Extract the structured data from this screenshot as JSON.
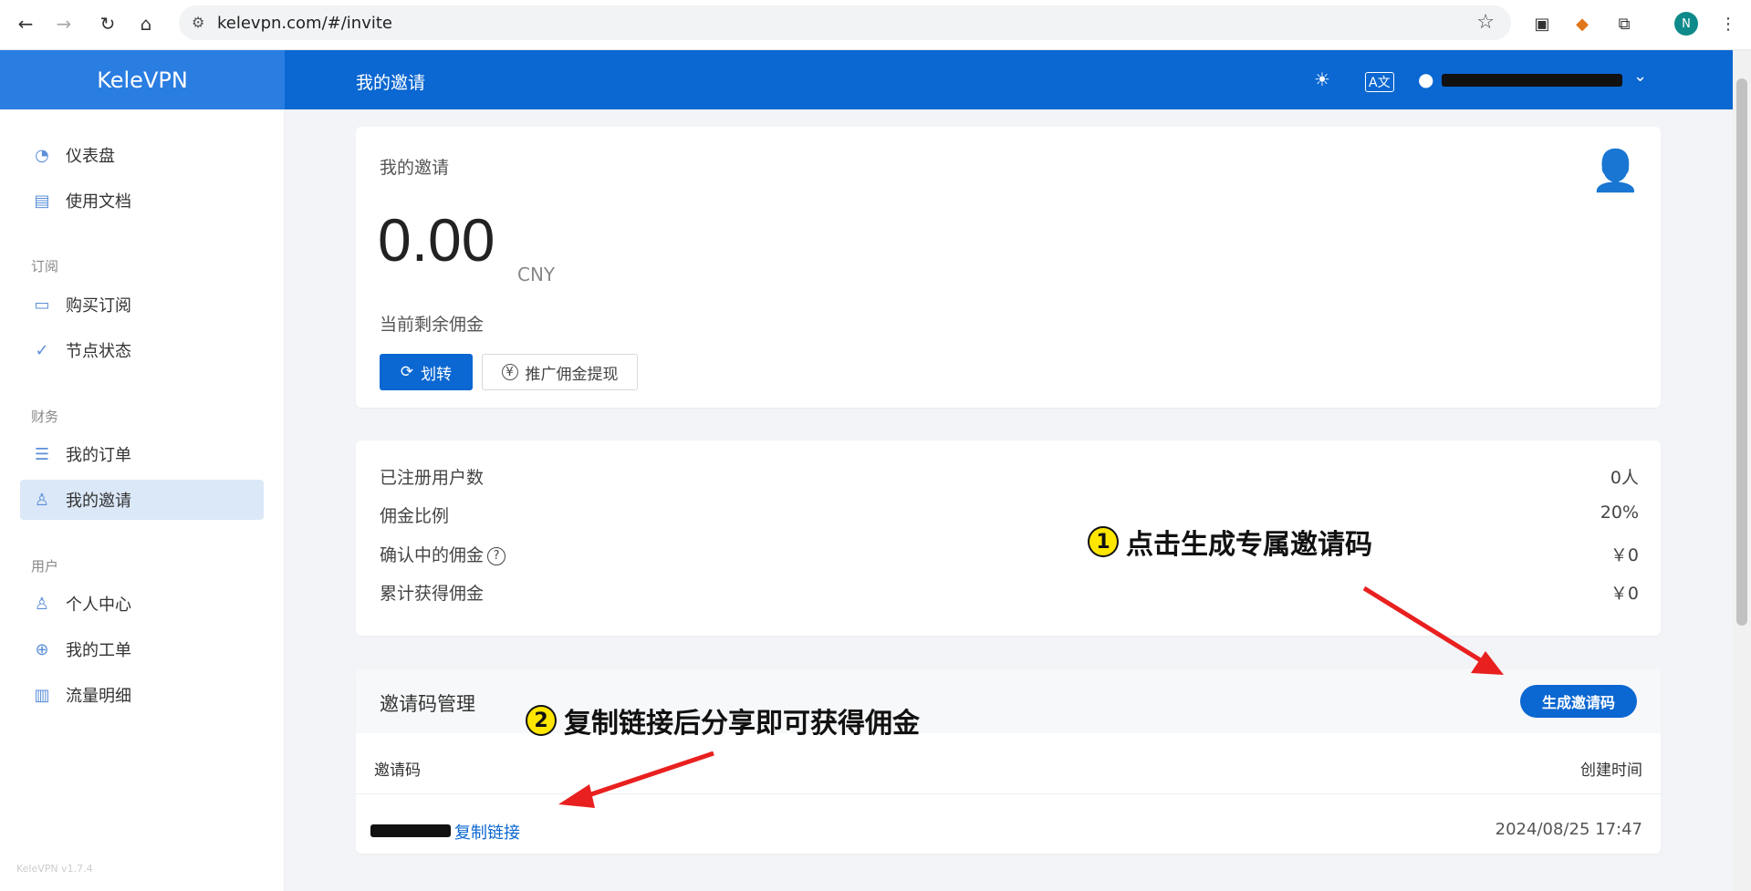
{
  "browser": {
    "url": "kelevpn.com/#/invite",
    "profile_initial": "N"
  },
  "app": {
    "brand": "KeleVPN",
    "page_title": "我的邀请",
    "version": "KeleVPN v1.7.4"
  },
  "sidebar": {
    "items_top": [
      {
        "label": "仪表盘",
        "icon": "dashboard-icon"
      },
      {
        "label": "使用文档",
        "icon": "book-icon"
      }
    ],
    "group_subscribe": "订阅",
    "items_subscribe": [
      {
        "label": "购买订阅",
        "icon": "bag-icon"
      },
      {
        "label": "节点状态",
        "icon": "check-circle-icon"
      }
    ],
    "group_finance": "财务",
    "items_finance": [
      {
        "label": "我的订单",
        "icon": "list-icon"
      },
      {
        "label": "我的邀请",
        "icon": "users-icon"
      }
    ],
    "group_user": "用户",
    "items_user": [
      {
        "label": "个人中心",
        "icon": "user-icon"
      },
      {
        "label": "我的工单",
        "icon": "lifebuoy-icon"
      },
      {
        "label": "流量明细",
        "icon": "bar-chart-icon"
      }
    ]
  },
  "commission": {
    "title": "我的邀请",
    "amount": "0.00",
    "currency": "CNY",
    "subtitle": "当前剩余佣金",
    "transfer_label": "划转",
    "withdraw_label": "推广佣金提现"
  },
  "stats": [
    {
      "label": "已注册用户数",
      "value": "0人"
    },
    {
      "label": "佣金比例",
      "value": "20%"
    },
    {
      "label": "确认中的佣金",
      "value": "￥0",
      "help": "?"
    },
    {
      "label": "累计获得佣金",
      "value": "￥0"
    }
  ],
  "invite_codes": {
    "title": "邀请码管理",
    "generate_label": "生成邀请码",
    "col_code": "邀请码",
    "col_created": "创建时间",
    "rows": [
      {
        "copy_label": "复制链接",
        "created": "2024/08/25 17:47"
      }
    ]
  },
  "annotations": {
    "step1_num": "1",
    "step1_text": "点击生成专属邀请码",
    "step2_num": "2",
    "step2_text": "复制链接后分享即可获得佣金"
  }
}
